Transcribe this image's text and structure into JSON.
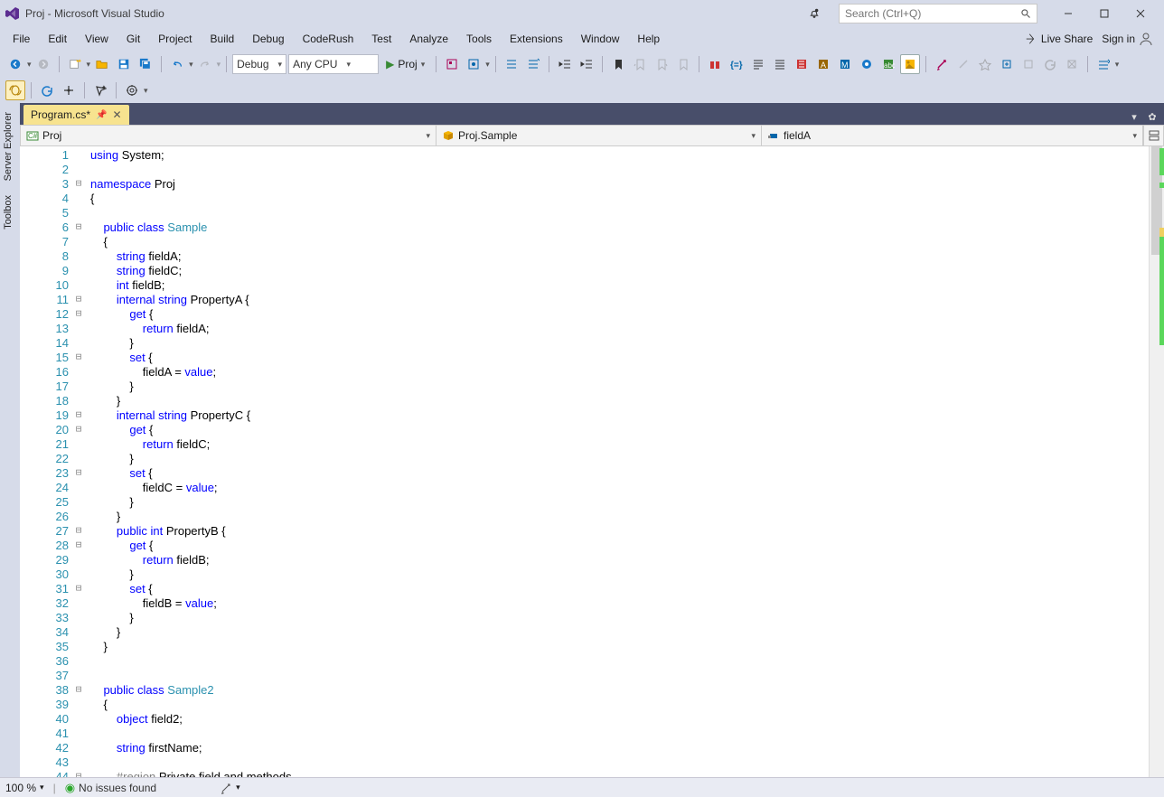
{
  "title": "Proj - Microsoft Visual Studio",
  "search": {
    "placeholder": "Search (Ctrl+Q)"
  },
  "menu": [
    "File",
    "Edit",
    "View",
    "Git",
    "Project",
    "Build",
    "Debug",
    "CodeRush",
    "Test",
    "Analyze",
    "Tools",
    "Extensions",
    "Window",
    "Help"
  ],
  "menubar_right": {
    "live_share": "Live Share",
    "sign_in": "Sign in"
  },
  "toolbar": {
    "config": "Debug",
    "platform": "Any CPU",
    "start_label": "Proj"
  },
  "doctab": {
    "label": "Program.cs*"
  },
  "nav": {
    "project": "Proj",
    "class": "Proj.Sample",
    "member": "fieldA"
  },
  "sidetabs": [
    "Server Explorer",
    "Toolbox"
  ],
  "status": {
    "zoom": "100 %",
    "issues": "No issues found"
  },
  "code_lines": [
    {
      "n": 1,
      "fold": " ",
      "html": "<span class='kw'>using</span> System;"
    },
    {
      "n": 2,
      "fold": " ",
      "html": ""
    },
    {
      "n": 3,
      "fold": "⊟",
      "html": "<span class='kw'>namespace</span> Proj"
    },
    {
      "n": 4,
      "fold": " ",
      "html": "{"
    },
    {
      "n": 5,
      "fold": " ",
      "html": ""
    },
    {
      "n": 6,
      "fold": "⊟",
      "html": "    <span class='kw'>public</span> <span class='kw'>class</span> <span class='type'>Sample</span>"
    },
    {
      "n": 7,
      "fold": " ",
      "html": "    {"
    },
    {
      "n": 8,
      "fold": " ",
      "html": "        <span class='kw'>string</span> fieldA;"
    },
    {
      "n": 9,
      "fold": " ",
      "html": "        <span class='kw'>string</span> fieldC;"
    },
    {
      "n": 10,
      "fold": " ",
      "html": "        <span class='kw'>int</span> fieldB;"
    },
    {
      "n": 11,
      "fold": "⊟",
      "html": "        <span class='kw'>internal</span> <span class='kw'>string</span> PropertyA {"
    },
    {
      "n": 12,
      "fold": "⊟",
      "html": "            <span class='kw'>get</span> {"
    },
    {
      "n": 13,
      "fold": " ",
      "html": "                <span class='kw'>return</span> fieldA;"
    },
    {
      "n": 14,
      "fold": " ",
      "html": "            }"
    },
    {
      "n": 15,
      "fold": "⊟",
      "html": "            <span class='kw'>set</span> {"
    },
    {
      "n": 16,
      "fold": " ",
      "html": "                fieldA = <span class='kw'>value</span>;"
    },
    {
      "n": 17,
      "fold": " ",
      "html": "            }"
    },
    {
      "n": 18,
      "fold": " ",
      "html": "        }"
    },
    {
      "n": 19,
      "fold": "⊟",
      "html": "        <span class='kw'>internal</span> <span class='kw'>string</span> PropertyC {"
    },
    {
      "n": 20,
      "fold": "⊟",
      "html": "            <span class='kw'>get</span> {"
    },
    {
      "n": 21,
      "fold": " ",
      "html": "                <span class='kw'>return</span> fieldC;"
    },
    {
      "n": 22,
      "fold": " ",
      "html": "            }"
    },
    {
      "n": 23,
      "fold": "⊟",
      "html": "            <span class='kw'>set</span> {"
    },
    {
      "n": 24,
      "fold": " ",
      "html": "                fieldC = <span class='kw'>value</span>;"
    },
    {
      "n": 25,
      "fold": " ",
      "html": "            }"
    },
    {
      "n": 26,
      "fold": " ",
      "html": "        }"
    },
    {
      "n": 27,
      "fold": "⊟",
      "html": "        <span class='kw'>public</span> <span class='kw'>int</span> PropertyB {"
    },
    {
      "n": 28,
      "fold": "⊟",
      "html": "            <span class='kw'>get</span> {"
    },
    {
      "n": 29,
      "fold": " ",
      "html": "                <span class='kw'>return</span> fieldB;"
    },
    {
      "n": 30,
      "fold": " ",
      "html": "            }"
    },
    {
      "n": 31,
      "fold": "⊟",
      "html": "            <span class='kw'>set</span> {"
    },
    {
      "n": 32,
      "fold": " ",
      "html": "                fieldB = <span class='kw'>value</span>;"
    },
    {
      "n": 33,
      "fold": " ",
      "html": "            }"
    },
    {
      "n": 34,
      "fold": " ",
      "html": "        }"
    },
    {
      "n": 35,
      "fold": " ",
      "html": "    }"
    },
    {
      "n": 36,
      "fold": " ",
      "html": ""
    },
    {
      "n": 37,
      "fold": " ",
      "html": ""
    },
    {
      "n": 38,
      "fold": "⊟",
      "html": "    <span class='kw'>public</span> <span class='kw'>class</span> <span class='type'>Sample2</span>"
    },
    {
      "n": 39,
      "fold": " ",
      "html": "    {"
    },
    {
      "n": 40,
      "fold": " ",
      "html": "        <span class='kw'>object</span> field2;"
    },
    {
      "n": 41,
      "fold": " ",
      "html": ""
    },
    {
      "n": 42,
      "fold": " ",
      "html": "        <span class='kw'>string</span> firstName;"
    },
    {
      "n": 43,
      "fold": " ",
      "html": ""
    },
    {
      "n": 44,
      "fold": "⊟",
      "html": "        <span class='reg'>#region</span> Private field and methods"
    }
  ]
}
